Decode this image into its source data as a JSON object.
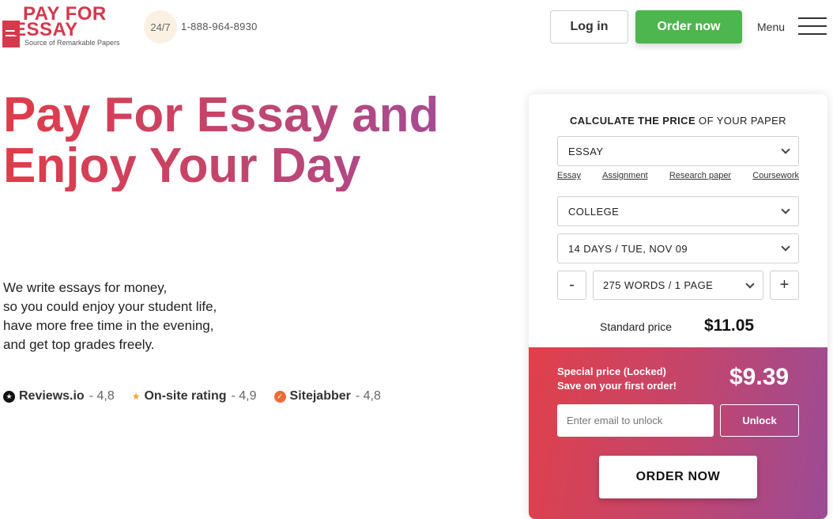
{
  "header": {
    "logo_line1": "PAY FOR",
    "logo_line2": "ESSAY",
    "logo_tagline": "Source of Remarkable Papers",
    "badge": "24/7",
    "phone": "1-888-964-8930",
    "login_label": "Log in",
    "order_label": "Order now",
    "menu_label": "Menu",
    "order_color": "#4db64f"
  },
  "hero": {
    "title": "Pay For Essay and Enjoy Your Day",
    "subtitle_lines": [
      "We write essays for money,",
      "so you could enjoy your student life,",
      "have more free time in the evening,",
      "and get top grades freely."
    ],
    "gradient_colors": [
      "#e03c49",
      "#a54b94"
    ]
  },
  "ratings": [
    {
      "icon": "reviews-io-icon",
      "name": "Reviews.io",
      "score": "- 4,8"
    },
    {
      "icon": "star-icon",
      "name": "On-site rating",
      "score": "- 4,9"
    },
    {
      "icon": "sitejabber-icon",
      "name": "Sitejabber",
      "score": "- 4,8"
    }
  ],
  "calculator": {
    "title_bold": "CALCULATE THE PRICE",
    "title_rest": " OF YOUR PAPER",
    "type_value": "ESSAY",
    "quick_types": [
      "Essay",
      "Assignment",
      "Research paper",
      "Coursework"
    ],
    "level_value": "COLLEGE",
    "deadline_value": "14 DAYS / TUE, NOV 09",
    "minus": "-",
    "plus": "+",
    "pages_value": "275 WORDS / 1 PAGE",
    "standard_label": "Standard price",
    "standard_price": "$11.05",
    "special_line1": "Special price (Locked)",
    "special_line2": "Save on your first order!",
    "special_price": "$9.39",
    "email_placeholder": "Enter email to unlock",
    "unlock_label": "Unlock",
    "order_now_label": "ORDER NOW"
  }
}
